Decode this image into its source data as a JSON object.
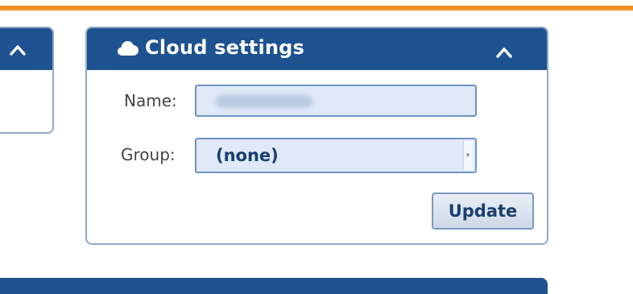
{
  "colors": {
    "accent_bar": "#f0901e",
    "panel_header": "#1e5290",
    "panel_border": "#8fa9c8",
    "input_bg": "#dfe9f7"
  },
  "cloud_settings": {
    "title": "Cloud settings",
    "title_icon": "cloud-icon",
    "collapse_icon": "chevron-up-icon",
    "name_label": "Name:",
    "name_value": "",
    "group_label": "Group:",
    "group_value": "(none)",
    "update_label": "Update"
  },
  "left_panel": {
    "collapse_icon": "chevron-up-icon"
  }
}
